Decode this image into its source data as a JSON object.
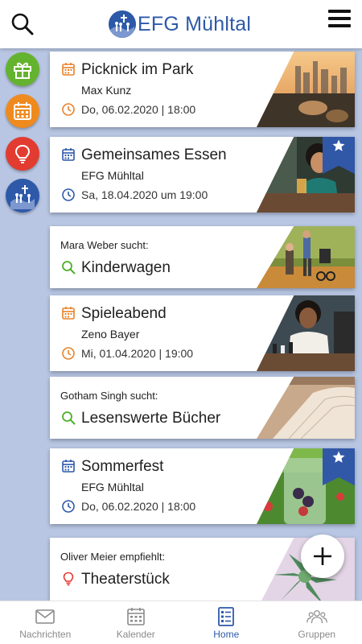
{
  "header": {
    "logo_text": "EFG Mühltal"
  },
  "colors": {
    "brand": "#2d59a8",
    "background": "#b8c6e3",
    "event_icon": "#e8822a",
    "search_icon": "#4caf28",
    "recommend_icon": "#e53935"
  },
  "sidebar": [
    {
      "name": "gift",
      "color": "#64b32e"
    },
    {
      "name": "calendar",
      "color": "#ef8a1f"
    },
    {
      "name": "lightbulb",
      "color": "#e23b30"
    },
    {
      "name": "groups",
      "color": "#2d59a8"
    }
  ],
  "cards": [
    {
      "kind": "event",
      "title": "Picknick im Park",
      "organizer": "Max Kunz",
      "date": "Do, 06.02.2020 | 18:00",
      "icon_color": "orange",
      "starred": false
    },
    {
      "kind": "event",
      "title": "Gemeinsames Essen",
      "organizer": "EFG Mühltal",
      "date": "Sa, 18.04.2020 um 19:00",
      "icon_color": "blue",
      "starred": true
    },
    {
      "kind": "search",
      "person": "Mara Weber",
      "verb": "sucht:",
      "title": "Kinderwagen"
    },
    {
      "kind": "event",
      "title": "Spieleabend",
      "organizer": "Zeno Bayer",
      "date": "Mi, 01.04.2020 | 19:00",
      "icon_color": "orange",
      "starred": false
    },
    {
      "kind": "search",
      "person": "Gotham Singh",
      "verb": "sucht:",
      "title": "Lesenswerte Bücher"
    },
    {
      "kind": "event",
      "title": "Sommerfest",
      "organizer": "EFG Mühltal",
      "date": "Do, 06.02.2020 | 18:00",
      "icon_color": "blue",
      "starred": true
    },
    {
      "kind": "recommend",
      "person": "Oliver Meier",
      "verb": "empfiehlt:",
      "title": "Theaterstück"
    }
  ],
  "bottom_nav": [
    {
      "label": "Nachrichten",
      "icon": "mail-icon",
      "active": false
    },
    {
      "label": "Kalender",
      "icon": "calendar-icon",
      "active": false
    },
    {
      "label": "Home",
      "icon": "home-list-icon",
      "active": true
    },
    {
      "label": "Gruppen",
      "icon": "people-icon",
      "active": false
    }
  ]
}
